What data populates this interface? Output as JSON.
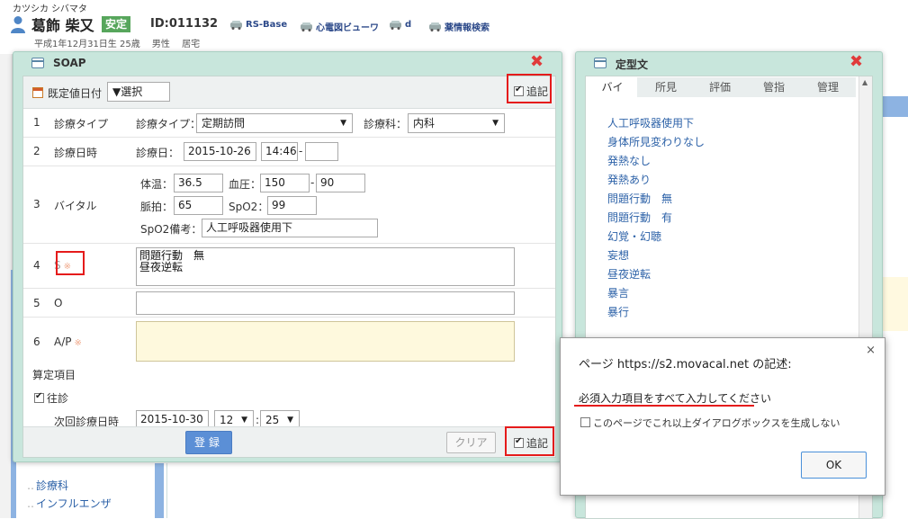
{
  "patient": {
    "kana": "カツシカ シバマタ",
    "name": "葛飾 柴又",
    "status_badge": "安定",
    "id": "ID:011132",
    "birth": "平成1年12月31日生 25歳",
    "sex": "男性",
    "residence": "居宅",
    "links": [
      "RS-Base",
      "心電図ビューワ",
      "d",
      "薬情報検索"
    ]
  },
  "background_nav": [
    "診療科",
    "インフルエンザ"
  ],
  "soap": {
    "title": "SOAP",
    "default_date_label": "既定値日付",
    "default_select": "▼選択",
    "append_label": "追記",
    "rows": {
      "type": {
        "num": "1",
        "label": "診療タイプ",
        "type_label": "診療タイプ：",
        "type_value": "定期訪問",
        "dept_label": "診療科：",
        "dept_value": "内科"
      },
      "date": {
        "num": "2",
        "label": "診療日時",
        "date_label": "診療日：",
        "date_value": "2015-10-26",
        "time_value": "14:46",
        "dash": "-",
        "end_value": ""
      },
      "vital": {
        "num": "3",
        "label": "バイタル",
        "temp_label": "体温：",
        "temp": "36.5",
        "bp_label": "血圧：",
        "bp_high": "150",
        "bp_dash": "-",
        "bp_low": "90",
        "pulse_label": "脈拍：",
        "pulse": "65",
        "spo2_label": "SpO2：",
        "spo2": "99",
        "spo2_note_label": "SpO2備考：",
        "spo2_note": "人工呼吸器使用下"
      },
      "s": {
        "num": "4",
        "label": "S",
        "required_mark": "※",
        "text": "問題行動　無\n昼夜逆転"
      },
      "o": {
        "num": "5",
        "label": "O",
        "text": ""
      },
      "ap": {
        "num": "6",
        "label": "A/P",
        "required_mark": "※",
        "text": ""
      }
    },
    "billing": {
      "title": "算定項目",
      "visit_label": "往診",
      "next_label": "次回診療日時",
      "next_date": "2015-10-30",
      "next_hour": "12",
      "next_minute": "25",
      "colon": ":"
    },
    "register_button": "登録",
    "clear_button": "クリア"
  },
  "teikei": {
    "title": "定型文",
    "tabs": [
      "バイ",
      "所見",
      "評価",
      "管指",
      "管理"
    ],
    "phrases": [
      "人工呼吸器使用下",
      "身体所見変わりなし",
      "発熱なし",
      "発熱あり",
      "問題行動　無",
      "問題行動　有",
      "幻覚・幻聴",
      "妄想",
      "昼夜逆転",
      "暴言",
      "暴行"
    ]
  },
  "alert": {
    "title": "ページ https://s2.movacal.net の記述:",
    "message": "必須入力項目をすべて入力してください",
    "suppress_label": "このページでこれ以上ダイアログボックスを生成しない",
    "ok_button": "OK",
    "close_glyph": "×"
  },
  "colors": {
    "dialog_bg": "#c8e6dc",
    "badge_green": "#57a65c",
    "link_blue": "#2d62a8",
    "primary_button": "#5b8fd6",
    "highlight_red": "#e51b1b",
    "close_red": "#e03a3a"
  }
}
